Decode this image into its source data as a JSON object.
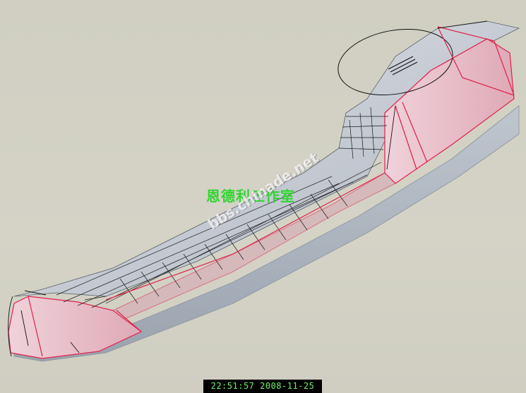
{
  "watermark": {
    "studio": "恩德利工作室",
    "url": "bbs.chinade.net"
  },
  "status": {
    "timestamp": "22:51:57 2008-11-25"
  },
  "colors": {
    "background": "#d2d1c4",
    "surface": "#c7cdd6",
    "pink_face": "#e8b9c6",
    "edge_red": "#e0204a",
    "grid": "#1a1a1a",
    "timestamp_text": "#6ef06e"
  }
}
